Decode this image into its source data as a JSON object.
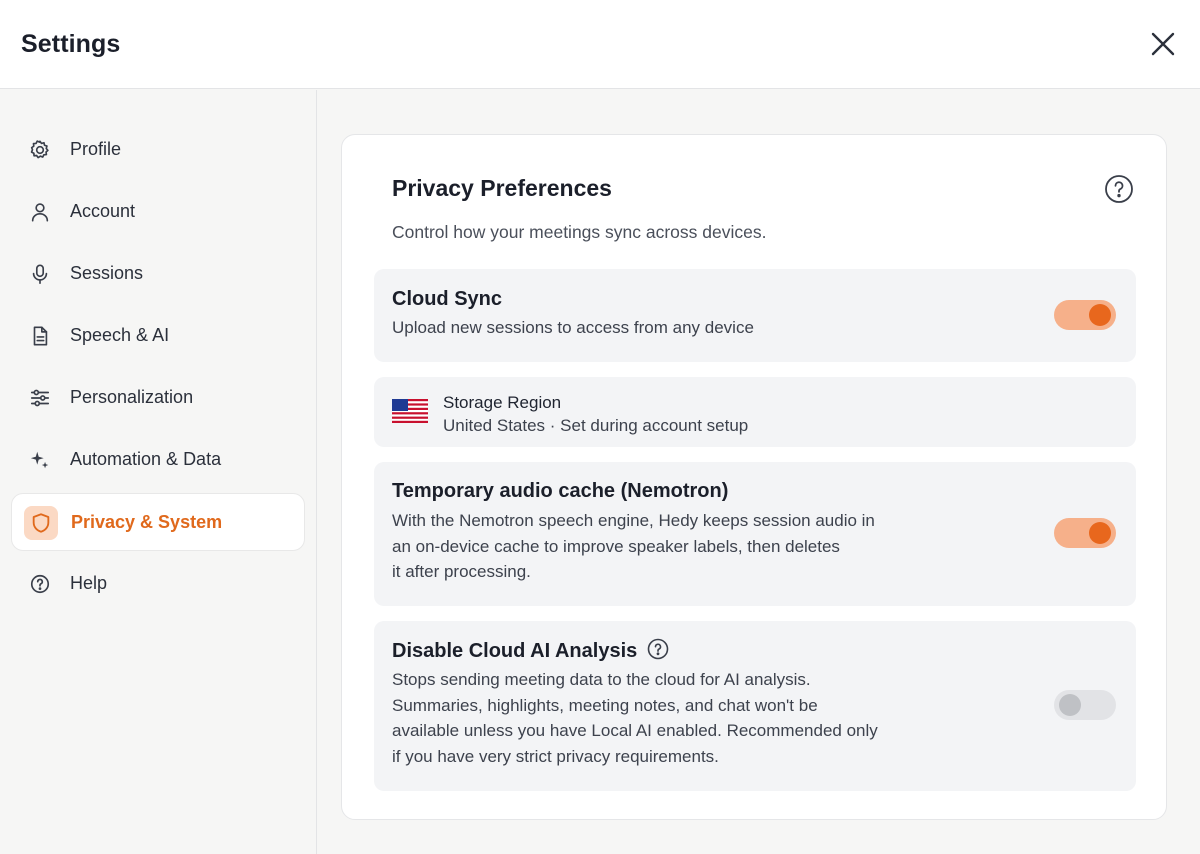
{
  "header": {
    "title": "Settings",
    "close_icon": "close-icon"
  },
  "sidebar": {
    "items": [
      {
        "label": "Profile",
        "icon": "gear-icon",
        "active": false
      },
      {
        "label": "Account",
        "icon": "user-icon",
        "active": false
      },
      {
        "label": "Sessions",
        "icon": "microphone-icon",
        "active": false
      },
      {
        "label": "Speech & AI",
        "icon": "document-icon",
        "active": false
      },
      {
        "label": "Personalization",
        "icon": "sliders-icon",
        "active": false
      },
      {
        "label": "Automation & Data",
        "icon": "sparkle-icon",
        "active": false
      },
      {
        "label": "Privacy & System",
        "icon": "shield-icon",
        "active": true
      },
      {
        "label": "Help",
        "icon": "help-circle-icon",
        "active": false
      }
    ],
    "active_color": "#e0691c"
  },
  "panel": {
    "title": "Privacy Preferences",
    "subtitle": "Control how your meetings sync across devices.",
    "help_icon": "help-circle-icon",
    "cloud_sync": {
      "title": "Cloud Sync",
      "description": "Upload new sessions to access from any device",
      "enabled": true
    },
    "storage_region": {
      "label": "Storage Region",
      "value": "United States · Set during account setup",
      "flag_icon": "us-flag-icon"
    },
    "audio_cache": {
      "title": "Temporary audio cache (Nemotron)",
      "description_lines": [
        "With the Nemotron speech engine, Hedy keeps session audio in",
        "an on-device cache to improve speaker labels, then deletes",
        "it after processing."
      ],
      "enabled": true
    },
    "disable_cloud_ai": {
      "title": "Disable Cloud AI Analysis",
      "description_lines": [
        "Stops sending meeting data to the cloud for AI analysis.",
        "Summaries, highlights, meeting notes, and chat won't be",
        "available unless you have Local AI enabled. Recommended only",
        "if you have very strict privacy requirements."
      ],
      "enabled": false
    }
  },
  "colors": {
    "accent": "#e8671d",
    "toggle_on_track": "#f6b08a",
    "toggle_off_track": "#e2e3e6"
  }
}
